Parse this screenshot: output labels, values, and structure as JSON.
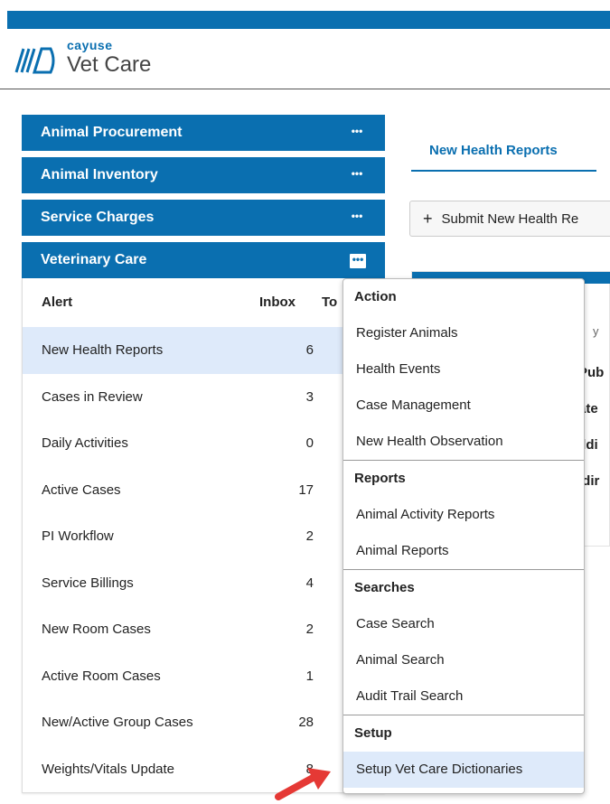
{
  "brand": {
    "small": "cayuse",
    "product": "Vet Care",
    "primary_color": "#0a6fb0",
    "highlight_color": "#deeafa"
  },
  "sidebar": {
    "categories": [
      {
        "label": "Animal Procurement",
        "more": "•••"
      },
      {
        "label": "Animal Inventory",
        "more": "•••"
      },
      {
        "label": "Service Charges",
        "more": "•••"
      },
      {
        "label": "Veterinary Care",
        "more": "•••"
      }
    ],
    "alerts_table": {
      "headers": {
        "alert": "Alert",
        "inbox": "Inbox",
        "third": "To"
      },
      "rows": [
        {
          "alert": "New Health Reports",
          "inbox": "6"
        },
        {
          "alert": "Cases in Review",
          "inbox": "3"
        },
        {
          "alert": "Daily Activities",
          "inbox": "0"
        },
        {
          "alert": "Active Cases",
          "inbox": "17"
        },
        {
          "alert": "PI Workflow",
          "inbox": "2"
        },
        {
          "alert": "Service Billings",
          "inbox": "4"
        },
        {
          "alert": "New Room Cases",
          "inbox": "2"
        },
        {
          "alert": "Active Room Cases",
          "inbox": "1"
        },
        {
          "alert": "New/Active Group Cases",
          "inbox": "28"
        },
        {
          "alert": "Weights/Vitals Update",
          "inbox": "8"
        }
      ]
    }
  },
  "main": {
    "tab": "New Health Reports",
    "submit_button": "Submit New Health Re",
    "background_cells": [
      "Pub",
      "ate",
      "ildi",
      "ldir"
    ],
    "background_header": "y"
  },
  "menu": {
    "sections": [
      {
        "title": "Action",
        "items": [
          "Register Animals",
          "Health Events",
          "Case Management",
          "New Health Observation"
        ]
      },
      {
        "title": "Reports",
        "items": [
          "Animal Activity Reports",
          "Animal Reports"
        ]
      },
      {
        "title": "Searches",
        "items": [
          "Case Search",
          "Animal Search",
          "Audit Trail Search"
        ]
      },
      {
        "title": "Setup",
        "items": [
          "Setup Vet Care Dictionaries"
        ]
      }
    ]
  }
}
